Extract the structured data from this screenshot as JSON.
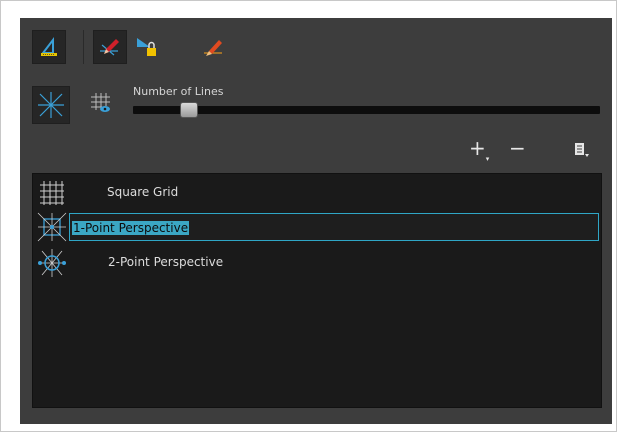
{
  "toolbar": {
    "tools": [
      {
        "name": "Perspective Ruler",
        "icon": "ruler-icon",
        "active": true
      },
      {
        "name": "Draw Guide",
        "icon": "pen-icon",
        "active": true
      },
      {
        "name": "Lock Guide",
        "icon": "lock-icon",
        "active": false
      },
      {
        "name": "Align Brush",
        "icon": "brush-icon",
        "active": false
      }
    ],
    "row2": [
      {
        "name": "Show Guide Lines",
        "icon": "vanishing-lines-icon",
        "active": true
      },
      {
        "name": "Show Grid",
        "icon": "grid-eye-icon",
        "active": false
      }
    ]
  },
  "lines_slider": {
    "label": "Number of Lines",
    "value": 0.12
  },
  "actions": {
    "add": "+",
    "remove": "−",
    "menu": "menu-icon"
  },
  "guides": [
    {
      "name": "Square Grid",
      "icon": "square-grid-icon",
      "selected": false
    },
    {
      "name": "1-Point Perspective",
      "icon": "one-point-perspective-icon",
      "selected": true
    },
    {
      "name": "2-Point Perspective",
      "icon": "two-point-perspective-icon",
      "selected": false
    }
  ],
  "colors": {
    "selection": "#3ba7c4",
    "panel": "#3d3d3d",
    "list": "#1a1a1a"
  }
}
